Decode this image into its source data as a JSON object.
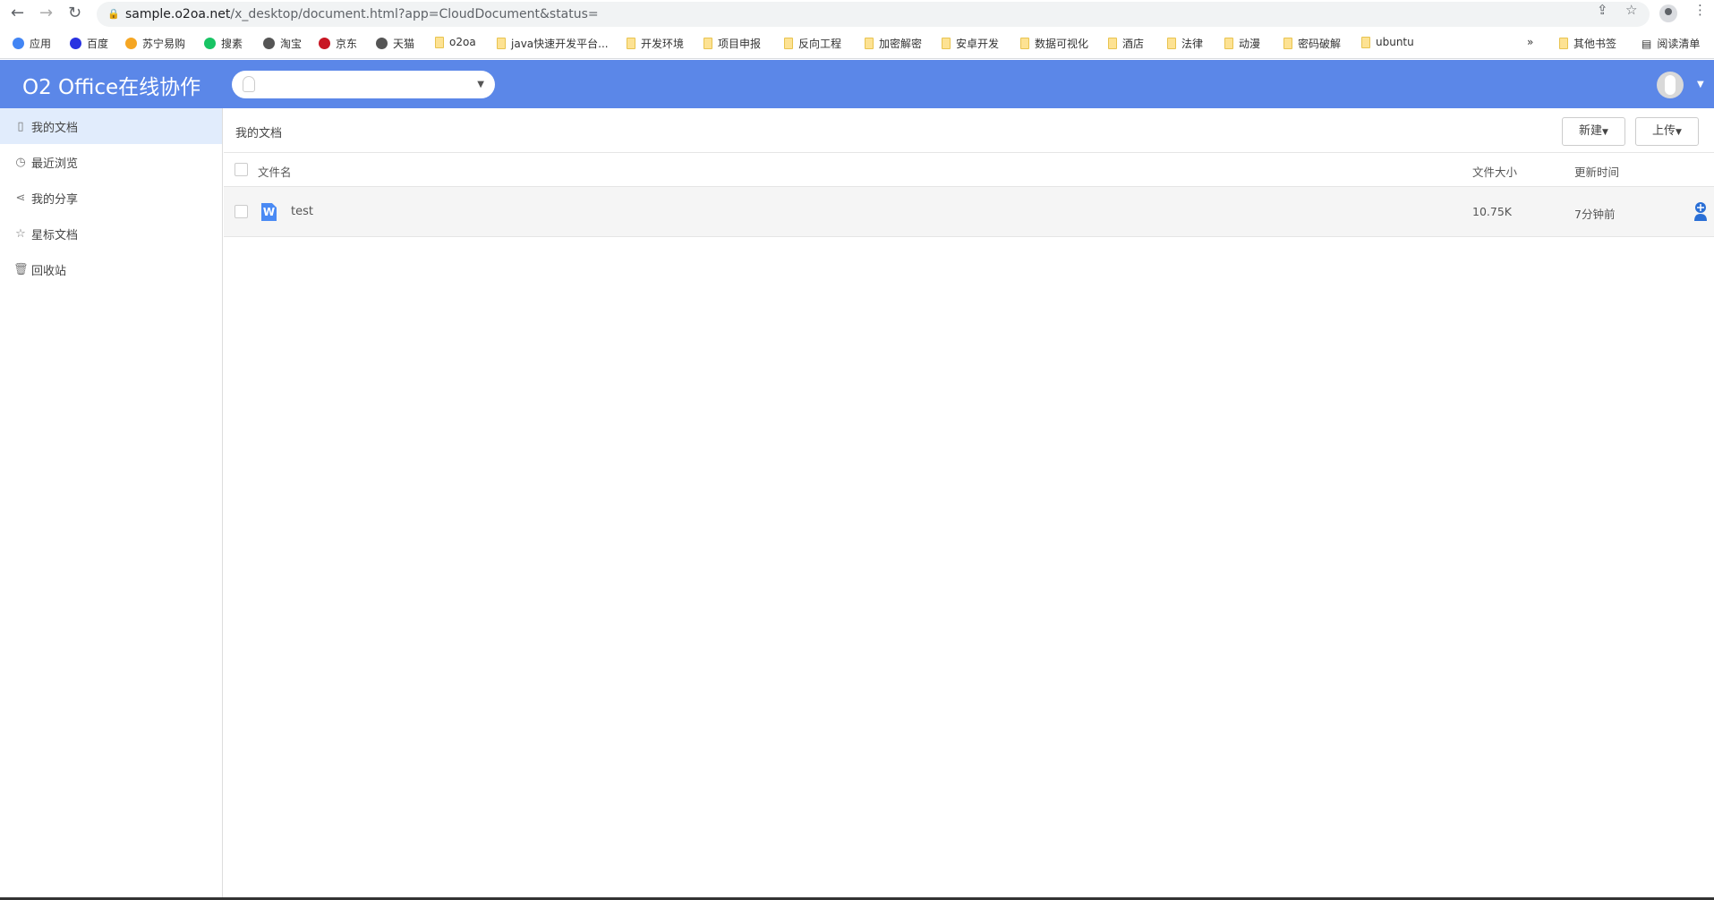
{
  "browser": {
    "url_host": "sample.o2oa.net",
    "url_path": "/x_desktop/document.html?app=CloudDocument&status=",
    "bookmarks": [
      "应用",
      "百度",
      "苏宁易购",
      "搜素",
      "淘宝",
      "京东",
      "天猫",
      "o2oa",
      "java快速开发平台...",
      "开发环境",
      "项目申报",
      "反向工程",
      "加密解密",
      "安卓开发",
      "数据可视化",
      "酒店",
      "法律",
      "动漫",
      "密码破解",
      "ubuntu"
    ],
    "overflow": "»",
    "other_bookmarks": "其他书签",
    "reading_list": "阅读清单"
  },
  "header": {
    "title": "O2 Office在线协作"
  },
  "sidebar": {
    "items": [
      {
        "label": "我的文档",
        "icon": "document-icon"
      },
      {
        "label": "最近浏览",
        "icon": "clock-icon"
      },
      {
        "label": "我的分享",
        "icon": "share-icon"
      },
      {
        "label": "星标文档",
        "icon": "star-icon"
      },
      {
        "label": "回收站",
        "icon": "trash-icon"
      }
    ]
  },
  "main": {
    "breadcrumb": "我的文档",
    "new_label": "新建",
    "upload_label": "上传",
    "columns": {
      "name": "文件名",
      "size": "文件大小",
      "updated": "更新时间"
    },
    "files": [
      {
        "name": "test",
        "size": "10.75K",
        "updated": "7分钟前"
      }
    ]
  },
  "colors": {
    "header": "#5b87e8",
    "active": "#e1ecfc",
    "word": "#4a8af4"
  }
}
